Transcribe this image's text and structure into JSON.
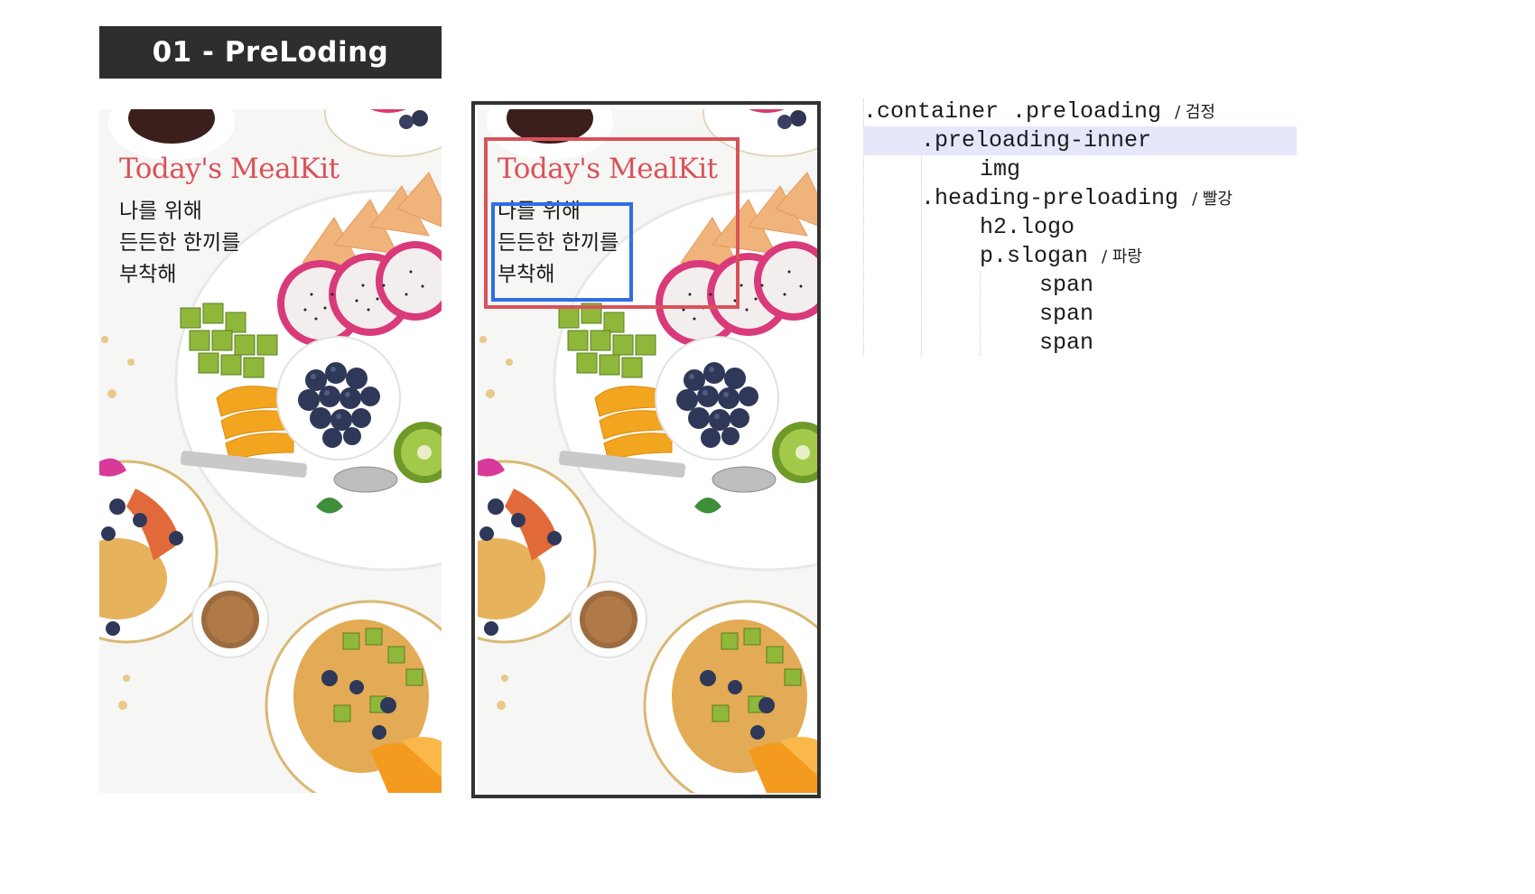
{
  "section_title": "01 - PreLoding",
  "mockup": {
    "logo": "Today's MealKit",
    "slogan": [
      "나를 위해",
      "든든한 한끼를",
      "부착해"
    ]
  },
  "code_tree": {
    "lines": [
      {
        "code": ".container .preloading",
        "note": "/ 검정",
        "highlight": false
      },
      {
        "code": ".preloading-inner",
        "note": "",
        "highlight": true
      },
      {
        "code": "img",
        "note": "",
        "highlight": false
      },
      {
        "code": ".heading-preloading",
        "note": "/ 빨강",
        "highlight": false
      },
      {
        "code": "h2.logo",
        "note": "",
        "highlight": false
      },
      {
        "code": "p.slogan",
        "note": "/ 파랑",
        "highlight": false
      },
      {
        "code": "span",
        "note": "",
        "highlight": false
      },
      {
        "code": "span",
        "note": "",
        "highlight": false
      },
      {
        "code": "span",
        "note": "",
        "highlight": false
      }
    ]
  },
  "colors": {
    "title_bar_bg": "#2e2e2e",
    "logo_red": "#d9525a",
    "annotation_red": "#d9525a",
    "annotation_blue": "#2f6ee6",
    "frame_dark": "#333333",
    "code_highlight": "#e5e7fb"
  }
}
